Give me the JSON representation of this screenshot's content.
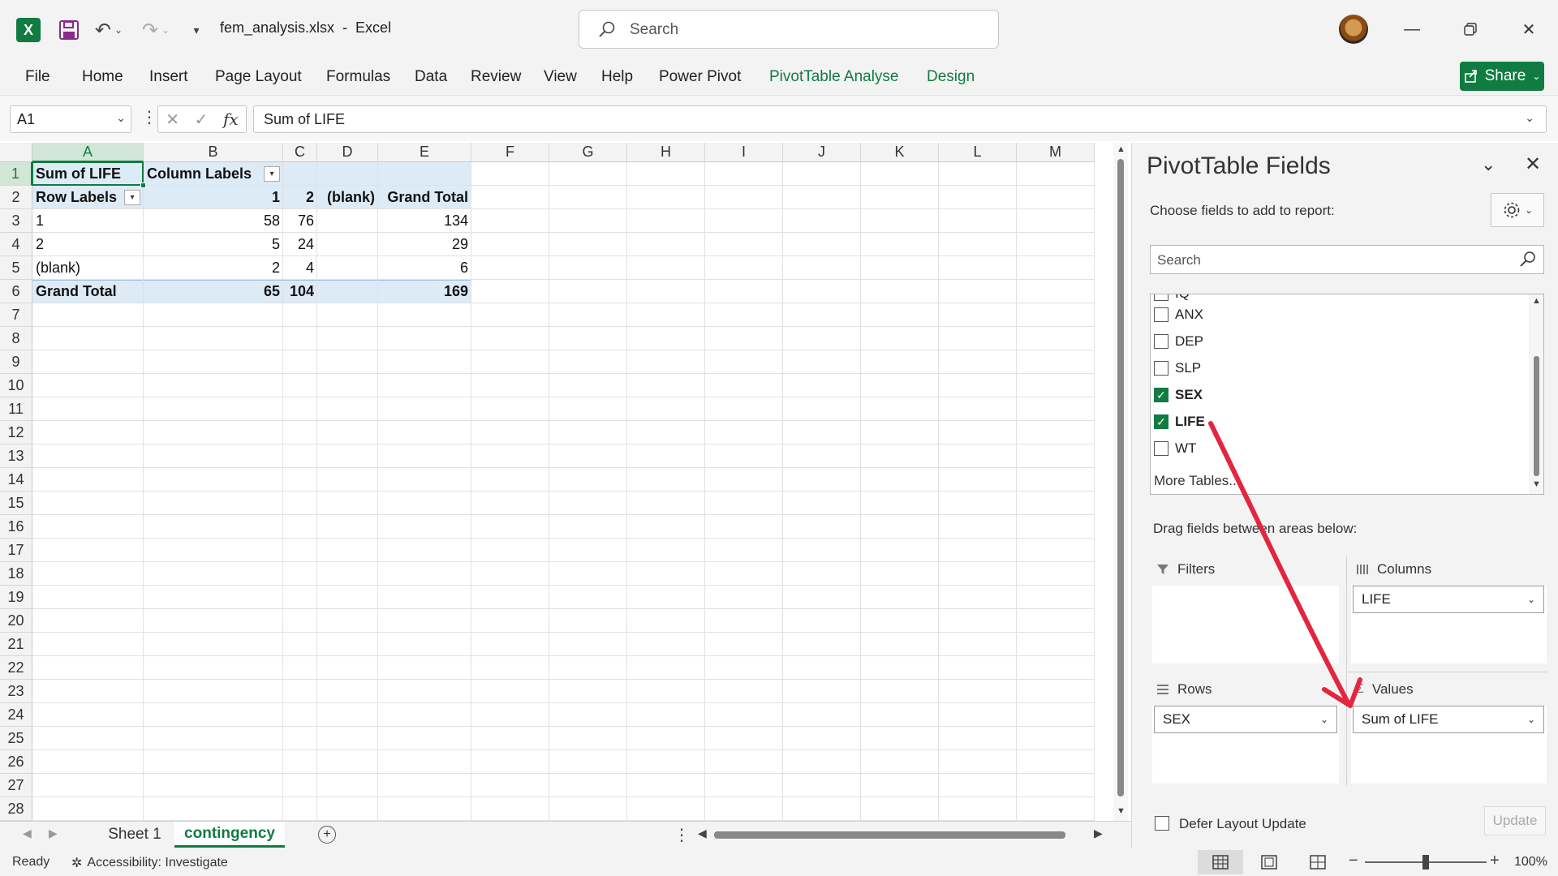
{
  "window": {
    "doc_title": "fem_analysis.xlsx  -  Excel",
    "search_placeholder": "Search"
  },
  "ribbon": {
    "tabs": [
      "File",
      "Home",
      "Insert",
      "Page Layout",
      "Formulas",
      "Data",
      "Review",
      "View",
      "Help",
      "Power Pivot",
      "PivotTable Analyse",
      "Design"
    ],
    "share_label": "Share"
  },
  "formula_bar": {
    "name_box": "A1",
    "formula": "Sum of LIFE"
  },
  "grid": {
    "columns": [
      "A",
      "B",
      "C",
      "D",
      "E",
      "F",
      "G",
      "H",
      "I",
      "J",
      "K",
      "L",
      "M"
    ],
    "rows": [
      "1",
      "2",
      "3",
      "4",
      "5",
      "6",
      "7",
      "8",
      "9",
      "10",
      "11",
      "12",
      "13",
      "14",
      "15",
      "16",
      "17",
      "18",
      "19",
      "20",
      "21",
      "22",
      "23",
      "24",
      "25",
      "26",
      "27",
      "28"
    ],
    "pivot": {
      "value_header": "Sum of LIFE",
      "column_labels": "Column Labels",
      "row_labels": "Row Labels",
      "col_keys": [
        "1",
        "2",
        "(blank)",
        "Grand Total"
      ],
      "body": [
        [
          "1",
          "58",
          "76",
          "",
          "134"
        ],
        [
          "2",
          "5",
          "24",
          "",
          "29"
        ],
        [
          "(blank)",
          "2",
          "4",
          "",
          "6"
        ]
      ],
      "grand_total_row": [
        "Grand Total",
        "65",
        "104",
        "",
        "169"
      ]
    }
  },
  "sheets": {
    "tabs": [
      "Sheet 1",
      "contingency"
    ],
    "active": "contingency"
  },
  "status": {
    "ready": "Ready",
    "accessibility": "Accessibility: Investigate",
    "zoom": "100%",
    "zoom_fraction": 0.5
  },
  "pivot_pane": {
    "title": "PivotTable Fields",
    "subtitle": "Choose fields to add to report:",
    "search_placeholder": "Search",
    "partial_field": "IQ",
    "fields": [
      {
        "name": "ANX",
        "checked": false
      },
      {
        "name": "DEP",
        "checked": false
      },
      {
        "name": "SLP",
        "checked": false
      },
      {
        "name": "SEX",
        "checked": true
      },
      {
        "name": "LIFE",
        "checked": true
      },
      {
        "name": "WT",
        "checked": false
      }
    ],
    "more_tables": "More Tables...",
    "drag_label": "Drag fields between areas below:",
    "areas": {
      "filters": {
        "label": "Filters",
        "items": []
      },
      "columns": {
        "label": "Columns",
        "items": [
          "LIFE"
        ]
      },
      "rows": {
        "label": "Rows",
        "items": [
          "SEX"
        ]
      },
      "values": {
        "label": "Values",
        "items": [
          "Sum of LIFE"
        ]
      }
    },
    "defer_label": "Defer Layout Update",
    "update_label": "Update"
  },
  "colors": {
    "excel_green": "#107c41",
    "pivot_header_fill": "#ddebf7",
    "annotation_arrow": "#e3263f"
  }
}
